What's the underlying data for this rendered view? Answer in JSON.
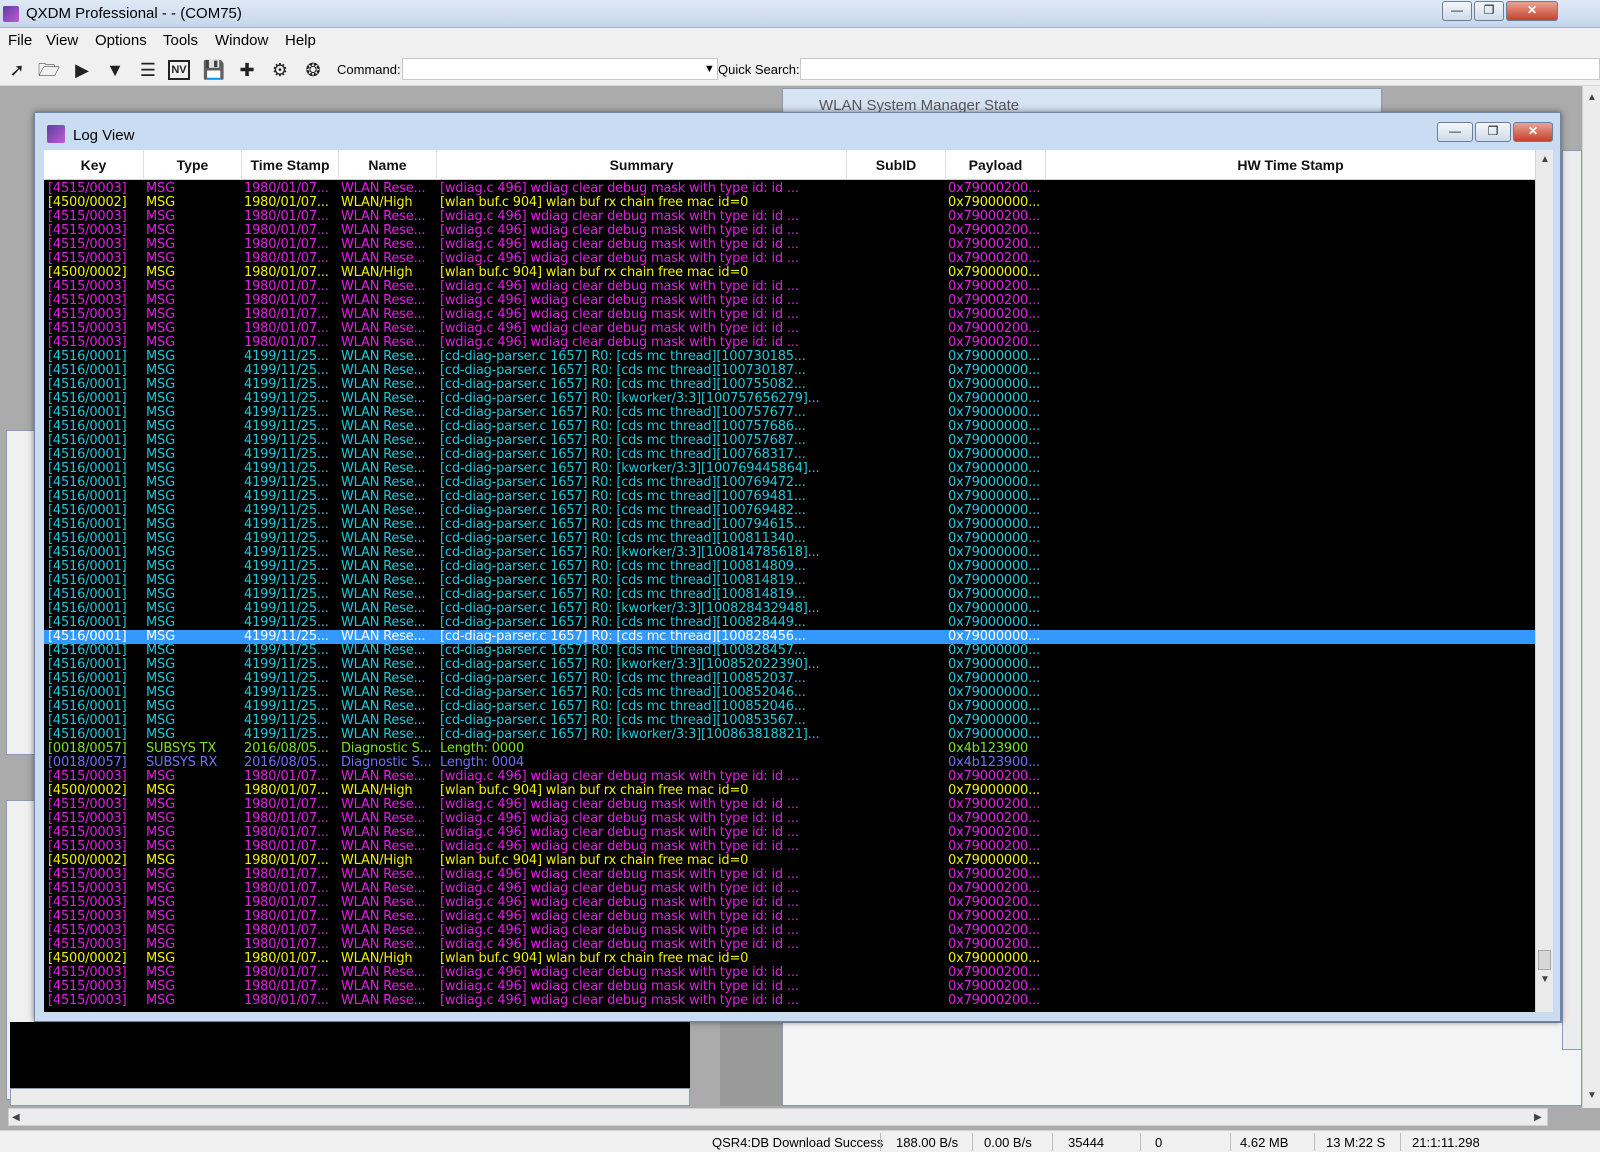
{
  "window": {
    "title": "QXDM Professional -  - (COM75)"
  },
  "menu": [
    "File",
    "View",
    "Options",
    "Tools",
    "Window",
    "Help"
  ],
  "toolbar": {
    "icons": [
      "connect-icon",
      "open-folder-icon",
      "play-icon",
      "filter-icon",
      "list-icon",
      "nv-icon",
      "save-icon",
      "add-icon",
      "settings-gear-icon",
      "steering-wheel-icon"
    ],
    "nv_label": "NV",
    "command_label": "Command:",
    "command_value": "",
    "quick_search_label": "Quick Search:",
    "quick_search_value": ""
  },
  "bg_window": {
    "title": "WLAN System Manager State"
  },
  "logview": {
    "title": "Log View",
    "columns": [
      "Key",
      "Type",
      "Time Stamp",
      "Name",
      "Summary",
      "SubID",
      "Payload",
      "HW Time Stamp"
    ],
    "colors": {
      "magenta": "#e020e0",
      "yellow": "#f0f000",
      "cyan": "#20c8d8",
      "green": "#80e020",
      "blue": "#7070f0"
    },
    "selected_index": 32,
    "rows": [
      {
        "key": "[4515/0003]",
        "type": "MSG",
        "ts": "1980/01/07...",
        "name": "WLAN Rese...",
        "summary": "[wdiag.c  496]  wdiag  clear  debug  mask  with  type  id:  id  ...",
        "payload": "0x79000200...",
        "color": "magenta"
      },
      {
        "key": "[4500/0002]",
        "type": "MSG",
        "ts": "1980/01/07...",
        "name": "WLAN/High",
        "summary": "[wlan  buf.c  904]  wlan  buf  rx  chain  free  mac  id=0",
        "payload": "0x79000000...",
        "color": "yellow"
      },
      {
        "key": "[4515/0003]",
        "type": "MSG",
        "ts": "1980/01/07...",
        "name": "WLAN Rese...",
        "summary": "[wdiag.c  496]  wdiag  clear  debug  mask  with  type  id:  id  ...",
        "payload": "0x79000200...",
        "color": "magenta"
      },
      {
        "key": "[4515/0003]",
        "type": "MSG",
        "ts": "1980/01/07...",
        "name": "WLAN Rese...",
        "summary": "[wdiag.c  496]  wdiag  clear  debug  mask  with  type  id:  id  ...",
        "payload": "0x79000200...",
        "color": "magenta"
      },
      {
        "key": "[4515/0003]",
        "type": "MSG",
        "ts": "1980/01/07...",
        "name": "WLAN Rese...",
        "summary": "[wdiag.c  496]  wdiag  clear  debug  mask  with  type  id:  id  ...",
        "payload": "0x79000200...",
        "color": "magenta"
      },
      {
        "key": "[4515/0003]",
        "type": "MSG",
        "ts": "1980/01/07...",
        "name": "WLAN Rese...",
        "summary": "[wdiag.c  496]  wdiag  clear  debug  mask  with  type  id:  id  ...",
        "payload": "0x79000200...",
        "color": "magenta"
      },
      {
        "key": "[4500/0002]",
        "type": "MSG",
        "ts": "1980/01/07...",
        "name": "WLAN/High",
        "summary": "[wlan  buf.c  904]  wlan  buf  rx  chain  free  mac  id=0",
        "payload": "0x79000000...",
        "color": "yellow"
      },
      {
        "key": "[4515/0003]",
        "type": "MSG",
        "ts": "1980/01/07...",
        "name": "WLAN Rese...",
        "summary": "[wdiag.c  496]  wdiag  clear  debug  mask  with  type  id:  id  ...",
        "payload": "0x79000200...",
        "color": "magenta"
      },
      {
        "key": "[4515/0003]",
        "type": "MSG",
        "ts": "1980/01/07...",
        "name": "WLAN Rese...",
        "summary": "[wdiag.c  496]  wdiag  clear  debug  mask  with  type  id:  id  ...",
        "payload": "0x79000200...",
        "color": "magenta"
      },
      {
        "key": "[4515/0003]",
        "type": "MSG",
        "ts": "1980/01/07...",
        "name": "WLAN Rese...",
        "summary": "[wdiag.c  496]  wdiag  clear  debug  mask  with  type  id:  id  ...",
        "payload": "0x79000200...",
        "color": "magenta"
      },
      {
        "key": "[4515/0003]",
        "type": "MSG",
        "ts": "1980/01/07...",
        "name": "WLAN Rese...",
        "summary": "[wdiag.c  496]  wdiag  clear  debug  mask  with  type  id:  id  ...",
        "payload": "0x79000200...",
        "color": "magenta"
      },
      {
        "key": "[4515/0003]",
        "type": "MSG",
        "ts": "1980/01/07...",
        "name": "WLAN Rese...",
        "summary": "[wdiag.c  496]  wdiag  clear  debug  mask  with  type  id:  id  ...",
        "payload": "0x79000200...",
        "color": "magenta"
      },
      {
        "key": "[4516/0001]",
        "type": "MSG",
        "ts": "4199/11/25...",
        "name": "WLAN Rese...",
        "summary": "[cd-diag-parser.c  1657]  R0:  [cds  mc  thread][100730185...",
        "payload": "0x79000000...",
        "color": "cyan"
      },
      {
        "key": "[4516/0001]",
        "type": "MSG",
        "ts": "4199/11/25...",
        "name": "WLAN Rese...",
        "summary": "[cd-diag-parser.c  1657]  R0:  [cds  mc  thread][100730187...",
        "payload": "0x79000000...",
        "color": "cyan"
      },
      {
        "key": "[4516/0001]",
        "type": "MSG",
        "ts": "4199/11/25...",
        "name": "WLAN Rese...",
        "summary": "[cd-diag-parser.c  1657]  R0:  [cds  mc  thread][100755082...",
        "payload": "0x79000000...",
        "color": "cyan"
      },
      {
        "key": "[4516/0001]",
        "type": "MSG",
        "ts": "4199/11/25...",
        "name": "WLAN Rese...",
        "summary": "[cd-diag-parser.c  1657]  R0:  [kworker/3:3][100757656279]...",
        "payload": "0x79000000...",
        "color": "cyan"
      },
      {
        "key": "[4516/0001]",
        "type": "MSG",
        "ts": "4199/11/25...",
        "name": "WLAN Rese...",
        "summary": "[cd-diag-parser.c  1657]  R0:  [cds  mc  thread][100757677...",
        "payload": "0x79000000...",
        "color": "cyan"
      },
      {
        "key": "[4516/0001]",
        "type": "MSG",
        "ts": "4199/11/25...",
        "name": "WLAN Rese...",
        "summary": "[cd-diag-parser.c  1657]  R0:  [cds  mc  thread][100757686...",
        "payload": "0x79000000...",
        "color": "cyan"
      },
      {
        "key": "[4516/0001]",
        "type": "MSG",
        "ts": "4199/11/25...",
        "name": "WLAN Rese...",
        "summary": "[cd-diag-parser.c  1657]  R0:  [cds  mc  thread][100757687...",
        "payload": "0x79000000...",
        "color": "cyan"
      },
      {
        "key": "[4516/0001]",
        "type": "MSG",
        "ts": "4199/11/25...",
        "name": "WLAN Rese...",
        "summary": "[cd-diag-parser.c  1657]  R0:  [cds  mc  thread][100768317...",
        "payload": "0x79000000...",
        "color": "cyan"
      },
      {
        "key": "[4516/0001]",
        "type": "MSG",
        "ts": "4199/11/25...",
        "name": "WLAN Rese...",
        "summary": "[cd-diag-parser.c  1657]  R0:  [kworker/3:3][100769445864]...",
        "payload": "0x79000000...",
        "color": "cyan"
      },
      {
        "key": "[4516/0001]",
        "type": "MSG",
        "ts": "4199/11/25...",
        "name": "WLAN Rese...",
        "summary": "[cd-diag-parser.c  1657]  R0:  [cds  mc  thread][100769472...",
        "payload": "0x79000000...",
        "color": "cyan"
      },
      {
        "key": "[4516/0001]",
        "type": "MSG",
        "ts": "4199/11/25...",
        "name": "WLAN Rese...",
        "summary": "[cd-diag-parser.c  1657]  R0:  [cds  mc  thread][100769481...",
        "payload": "0x79000000...",
        "color": "cyan"
      },
      {
        "key": "[4516/0001]",
        "type": "MSG",
        "ts": "4199/11/25...",
        "name": "WLAN Rese...",
        "summary": "[cd-diag-parser.c  1657]  R0:  [cds  mc  thread][100769482...",
        "payload": "0x79000000...",
        "color": "cyan"
      },
      {
        "key": "[4516/0001]",
        "type": "MSG",
        "ts": "4199/11/25...",
        "name": "WLAN Rese...",
        "summary": "[cd-diag-parser.c  1657]  R0:  [cds  mc  thread][100794615...",
        "payload": "0x79000000...",
        "color": "cyan"
      },
      {
        "key": "[4516/0001]",
        "type": "MSG",
        "ts": "4199/11/25...",
        "name": "WLAN Rese...",
        "summary": "[cd-diag-parser.c  1657]  R0:  [cds  mc  thread][100811340...",
        "payload": "0x79000000...",
        "color": "cyan"
      },
      {
        "key": "[4516/0001]",
        "type": "MSG",
        "ts": "4199/11/25...",
        "name": "WLAN Rese...",
        "summary": "[cd-diag-parser.c  1657]  R0:  [kworker/3:3][100814785618]...",
        "payload": "0x79000000...",
        "color": "cyan"
      },
      {
        "key": "[4516/0001]",
        "type": "MSG",
        "ts": "4199/11/25...",
        "name": "WLAN Rese...",
        "summary": "[cd-diag-parser.c  1657]  R0:  [cds  mc  thread][100814809...",
        "payload": "0x79000000...",
        "color": "cyan"
      },
      {
        "key": "[4516/0001]",
        "type": "MSG",
        "ts": "4199/11/25...",
        "name": "WLAN Rese...",
        "summary": "[cd-diag-parser.c  1657]  R0:  [cds  mc  thread][100814819...",
        "payload": "0x79000000...",
        "color": "cyan"
      },
      {
        "key": "[4516/0001]",
        "type": "MSG",
        "ts": "4199/11/25...",
        "name": "WLAN Rese...",
        "summary": "[cd-diag-parser.c  1657]  R0:  [cds  mc  thread][100814819...",
        "payload": "0x79000000...",
        "color": "cyan"
      },
      {
        "key": "[4516/0001]",
        "type": "MSG",
        "ts": "4199/11/25...",
        "name": "WLAN Rese...",
        "summary": "[cd-diag-parser.c  1657]  R0:  [kworker/3:3][100828432948]...",
        "payload": "0x79000000...",
        "color": "cyan"
      },
      {
        "key": "[4516/0001]",
        "type": "MSG",
        "ts": "4199/11/25...",
        "name": "WLAN Rese...",
        "summary": "[cd-diag-parser.c  1657]  R0:  [cds  mc  thread][100828449...",
        "payload": "0x79000000...",
        "color": "cyan"
      },
      {
        "key": "[4516/0001]",
        "type": "MSG",
        "ts": "4199/11/25...",
        "name": "WLAN Rese...",
        "summary": "[cd-diag-parser.c  1657]  R0:  [cds  mc  thread][100828456...",
        "payload": "0x79000000...",
        "color": "cyan"
      },
      {
        "key": "[4516/0001]",
        "type": "MSG",
        "ts": "4199/11/25...",
        "name": "WLAN Rese...",
        "summary": "[cd-diag-parser.c  1657]  R0:  [cds  mc  thread][100828457...",
        "payload": "0x79000000...",
        "color": "cyan"
      },
      {
        "key": "[4516/0001]",
        "type": "MSG",
        "ts": "4199/11/25...",
        "name": "WLAN Rese...",
        "summary": "[cd-diag-parser.c  1657]  R0:  [kworker/3:3][100852022390]...",
        "payload": "0x79000000...",
        "color": "cyan"
      },
      {
        "key": "[4516/0001]",
        "type": "MSG",
        "ts": "4199/11/25...",
        "name": "WLAN Rese...",
        "summary": "[cd-diag-parser.c  1657]  R0:  [cds  mc  thread][100852037...",
        "payload": "0x79000000...",
        "color": "cyan"
      },
      {
        "key": "[4516/0001]",
        "type": "MSG",
        "ts": "4199/11/25...",
        "name": "WLAN Rese...",
        "summary": "[cd-diag-parser.c  1657]  R0:  [cds  mc  thread][100852046...",
        "payload": "0x79000000...",
        "color": "cyan"
      },
      {
        "key": "[4516/0001]",
        "type": "MSG",
        "ts": "4199/11/25...",
        "name": "WLAN Rese...",
        "summary": "[cd-diag-parser.c  1657]  R0:  [cds  mc  thread][100852046...",
        "payload": "0x79000000...",
        "color": "cyan"
      },
      {
        "key": "[4516/0001]",
        "type": "MSG",
        "ts": "4199/11/25...",
        "name": "WLAN Rese...",
        "summary": "[cd-diag-parser.c  1657]  R0:  [cds  mc  thread][100853567...",
        "payload": "0x79000000...",
        "color": "cyan"
      },
      {
        "key": "[4516/0001]",
        "type": "MSG",
        "ts": "4199/11/25...",
        "name": "WLAN Rese...",
        "summary": "[cd-diag-parser.c  1657]  R0:  [kworker/3:3][100863818821]...",
        "payload": "0x79000000...",
        "color": "cyan"
      },
      {
        "key": "[0018/0057]",
        "type": "SUBSYS TX",
        "ts": "2016/08/05...",
        "name": "Diagnostic S...",
        "summary": "Length:  0000",
        "payload": "0x4b123900",
        "color": "green"
      },
      {
        "key": "[0018/0057]",
        "type": "SUBSYS RX",
        "ts": "2016/08/05...",
        "name": "Diagnostic S...",
        "summary": "Length:  0004",
        "payload": "0x4b123900...",
        "color": "blue"
      },
      {
        "key": "[4515/0003]",
        "type": "MSG",
        "ts": "1980/01/07...",
        "name": "WLAN Rese...",
        "summary": "[wdiag.c  496]  wdiag  clear  debug  mask  with  type  id:  id  ...",
        "payload": "0x79000200...",
        "color": "magenta"
      },
      {
        "key": "[4500/0002]",
        "type": "MSG",
        "ts": "1980/01/07...",
        "name": "WLAN/High",
        "summary": "[wlan  buf.c  904]  wlan  buf  rx  chain  free  mac  id=0",
        "payload": "0x79000000...",
        "color": "yellow"
      },
      {
        "key": "[4515/0003]",
        "type": "MSG",
        "ts": "1980/01/07...",
        "name": "WLAN Rese...",
        "summary": "[wdiag.c  496]  wdiag  clear  debug  mask  with  type  id:  id  ...",
        "payload": "0x79000200...",
        "color": "magenta"
      },
      {
        "key": "[4515/0003]",
        "type": "MSG",
        "ts": "1980/01/07...",
        "name": "WLAN Rese...",
        "summary": "[wdiag.c  496]  wdiag  clear  debug  mask  with  type  id:  id  ...",
        "payload": "0x79000200...",
        "color": "magenta"
      },
      {
        "key": "[4515/0003]",
        "type": "MSG",
        "ts": "1980/01/07...",
        "name": "WLAN Rese...",
        "summary": "[wdiag.c  496]  wdiag  clear  debug  mask  with  type  id:  id  ...",
        "payload": "0x79000200...",
        "color": "magenta"
      },
      {
        "key": "[4515/0003]",
        "type": "MSG",
        "ts": "1980/01/07...",
        "name": "WLAN Rese...",
        "summary": "[wdiag.c  496]  wdiag  clear  debug  mask  with  type  id:  id  ...",
        "payload": "0x79000200...",
        "color": "magenta"
      },
      {
        "key": "[4500/0002]",
        "type": "MSG",
        "ts": "1980/01/07...",
        "name": "WLAN/High",
        "summary": "[wlan  buf.c  904]  wlan  buf  rx  chain  free  mac  id=0",
        "payload": "0x79000000...",
        "color": "yellow"
      },
      {
        "key": "[4515/0003]",
        "type": "MSG",
        "ts": "1980/01/07...",
        "name": "WLAN Rese...",
        "summary": "[wdiag.c  496]  wdiag  clear  debug  mask  with  type  id:  id  ...",
        "payload": "0x79000200...",
        "color": "magenta"
      },
      {
        "key": "[4515/0003]",
        "type": "MSG",
        "ts": "1980/01/07...",
        "name": "WLAN Rese...",
        "summary": "[wdiag.c  496]  wdiag  clear  debug  mask  with  type  id:  id  ...",
        "payload": "0x79000200...",
        "color": "magenta"
      },
      {
        "key": "[4515/0003]",
        "type": "MSG",
        "ts": "1980/01/07...",
        "name": "WLAN Rese...",
        "summary": "[wdiag.c  496]  wdiag  clear  debug  mask  with  type  id:  id  ...",
        "payload": "0x79000200...",
        "color": "magenta"
      },
      {
        "key": "[4515/0003]",
        "type": "MSG",
        "ts": "1980/01/07...",
        "name": "WLAN Rese...",
        "summary": "[wdiag.c  496]  wdiag  clear  debug  mask  with  type  id:  id  ...",
        "payload": "0x79000200...",
        "color": "magenta"
      },
      {
        "key": "[4515/0003]",
        "type": "MSG",
        "ts": "1980/01/07...",
        "name": "WLAN Rese...",
        "summary": "[wdiag.c  496]  wdiag  clear  debug  mask  with  type  id:  id  ...",
        "payload": "0x79000200...",
        "color": "magenta"
      },
      {
        "key": "[4515/0003]",
        "type": "MSG",
        "ts": "1980/01/07...",
        "name": "WLAN Rese...",
        "summary": "[wdiag.c  496]  wdiag  clear  debug  mask  with  type  id:  id  ...",
        "payload": "0x79000200...",
        "color": "magenta"
      },
      {
        "key": "[4500/0002]",
        "type": "MSG",
        "ts": "1980/01/07...",
        "name": "WLAN/High",
        "summary": "[wlan  buf.c  904]  wlan  buf  rx  chain  free  mac  id=0",
        "payload": "0x79000000...",
        "color": "yellow"
      },
      {
        "key": "[4515/0003]",
        "type": "MSG",
        "ts": "1980/01/07...",
        "name": "WLAN Rese...",
        "summary": "[wdiag.c  496]  wdiag  clear  debug  mask  with  type  id:  id  ...",
        "payload": "0x79000200...",
        "color": "magenta"
      },
      {
        "key": "[4515/0003]",
        "type": "MSG",
        "ts": "1980/01/07...",
        "name": "WLAN Rese...",
        "summary": "[wdiag.c  496]  wdiag  clear  debug  mask  with  type  id:  id  ...",
        "payload": "0x79000200...",
        "color": "magenta"
      },
      {
        "key": "[4515/0003]",
        "type": "MSG",
        "ts": "1980/01/07...",
        "name": "WLAN Rese...",
        "summary": "[wdiag.c  496]  wdiag  clear  debug  mask  with  type  id:  id  ...",
        "payload": "0x79000200...",
        "color": "magenta"
      }
    ]
  },
  "statusbar": {
    "message": "QSR4:DB Download Success",
    "rate_in": "188.00 B/s",
    "rate_out": "0.00 B/s",
    "items": "35444",
    "errors": "0",
    "size": "4.62 MB",
    "elapsed": "13 M:22 S",
    "clock": "21:1:11.298"
  }
}
